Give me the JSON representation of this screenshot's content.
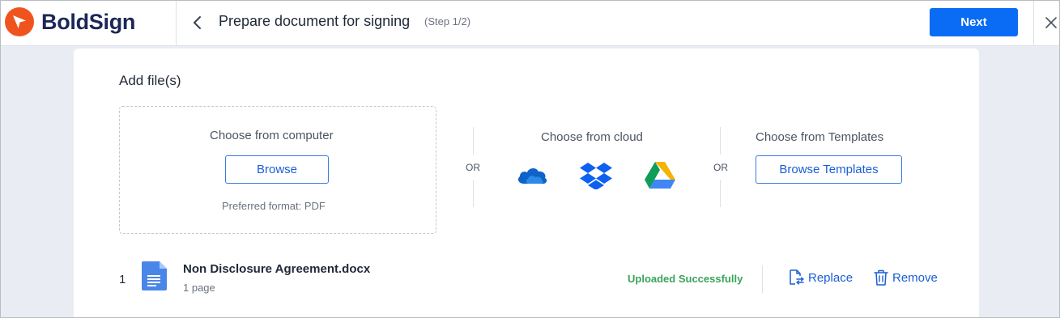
{
  "header": {
    "brand": "BoldSign",
    "title": "Prepare document for signing",
    "step": "(Step 1/2)",
    "next_label": "Next"
  },
  "add_files": {
    "title": "Add file(s)",
    "computer": {
      "label": "Choose from computer",
      "browse_label": "Browse",
      "hint": "Preferred format: PDF"
    },
    "or_label": "OR",
    "cloud": {
      "label": "Choose from cloud",
      "providers": [
        "onedrive-icon",
        "dropbox-icon",
        "google-drive-icon"
      ]
    },
    "templates": {
      "label": "Choose from Templates",
      "browse_label": "Browse Templates"
    }
  },
  "files": [
    {
      "index": "1",
      "name": "Non Disclosure Agreement.docx",
      "pages": "1 page",
      "status": "Uploaded Successfully",
      "replace_label": "Replace",
      "remove_label": "Remove"
    }
  ],
  "colors": {
    "brand_orange": "#f0541e",
    "brand_navy": "#1c2757",
    "primary": "#0a6cf5",
    "success": "#3aa35a"
  }
}
